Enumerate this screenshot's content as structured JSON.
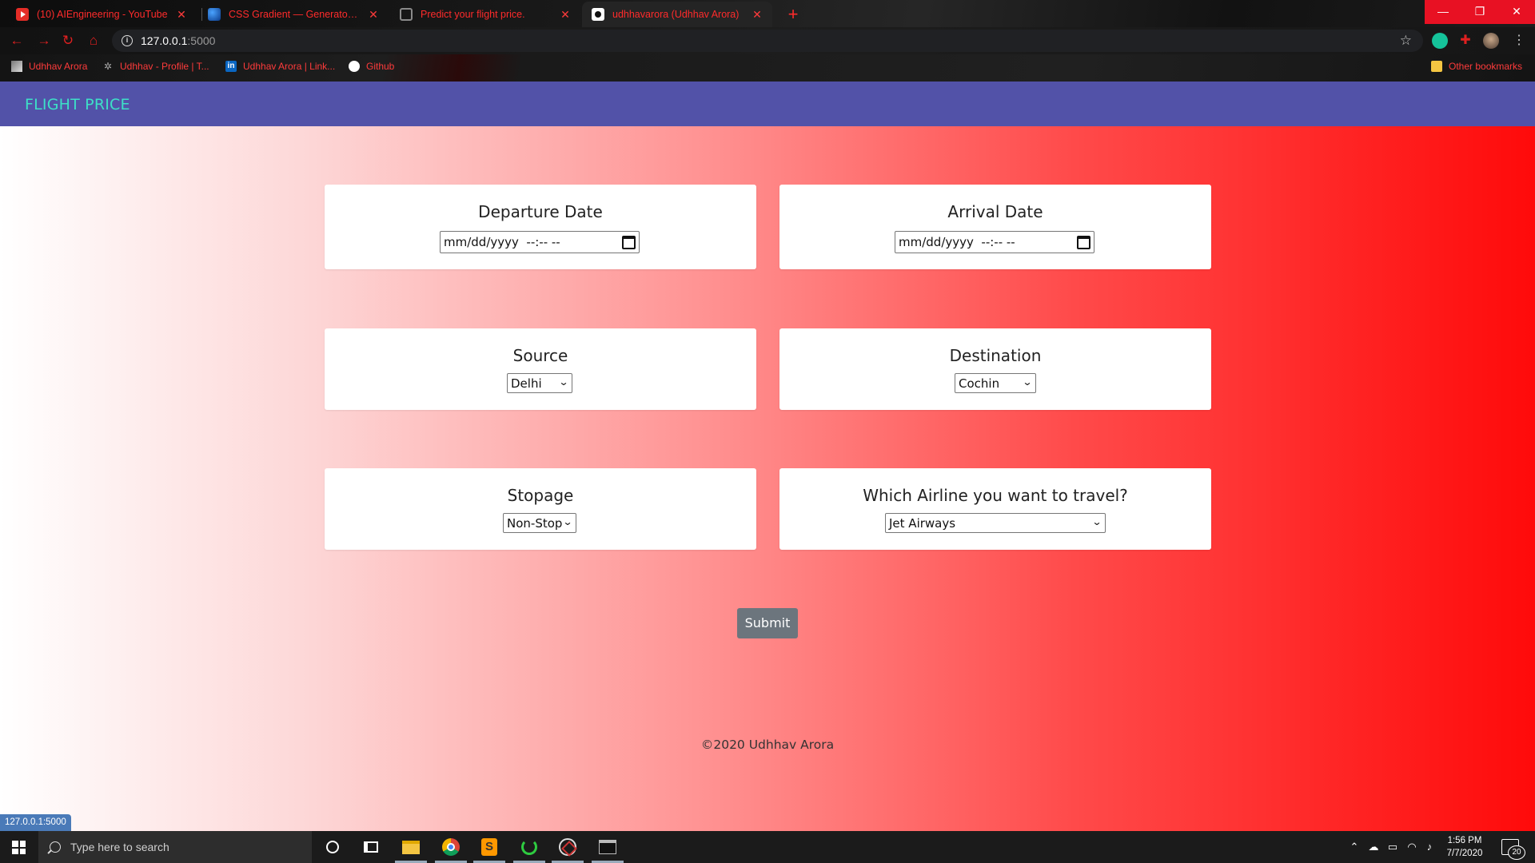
{
  "browser": {
    "tabs": [
      {
        "label": "(10) AIEngineering - YouTube",
        "icon": "youtube-icon"
      },
      {
        "label": "CSS Gradient — Generator, Mak",
        "icon": "css-gradient-icon"
      },
      {
        "label": "Predict your flight price.",
        "icon": "globe-icon"
      },
      {
        "label": "udhhavarora (Udhhav Arora)",
        "icon": "github-icon",
        "active": true
      }
    ],
    "new_tab_label": "+",
    "url_host": "127.0.0.1",
    "url_port": ":5000",
    "bookmarks": [
      {
        "label": "Udhhav Arora",
        "icon": "profile-photo-icon"
      },
      {
        "label": "Udhhav - Profile | T...",
        "icon": "kaggle-icon"
      },
      {
        "label": "Udhhav Arora | Link...",
        "icon": "linkedin-icon"
      },
      {
        "label": "Github",
        "icon": "github-icon"
      }
    ],
    "other_bookmarks": "Other bookmarks",
    "status_url": "127.0.0.1:5000"
  },
  "app": {
    "brand": "FLIGHT PRICE",
    "departure": {
      "title": "Departure Date",
      "placeholder": "mm/dd/yyyy  --:-- --"
    },
    "arrival": {
      "title": "Arrival Date",
      "placeholder": "mm/dd/yyyy  --:-- --"
    },
    "source": {
      "title": "Source",
      "value": "Delhi"
    },
    "destination": {
      "title": "Destination",
      "value": "Cochin"
    },
    "stopage": {
      "title": "Stopage",
      "value": "Non-Stop"
    },
    "airline": {
      "title": "Which Airline you want to travel?",
      "value": "Jet Airways"
    },
    "submit_label": "Submit",
    "footer": "©2020 Udhhav Arora",
    "colors": {
      "navbar": "#5252a8",
      "brand": "#3de0c7",
      "gradient_start": "#ffffff",
      "gradient_end": "#ff0a0a",
      "button": "#6c757d"
    }
  },
  "taskbar": {
    "search_placeholder": "Type here to search",
    "time": "1:56 PM",
    "date": "7/7/2020",
    "notification_count": "20"
  }
}
